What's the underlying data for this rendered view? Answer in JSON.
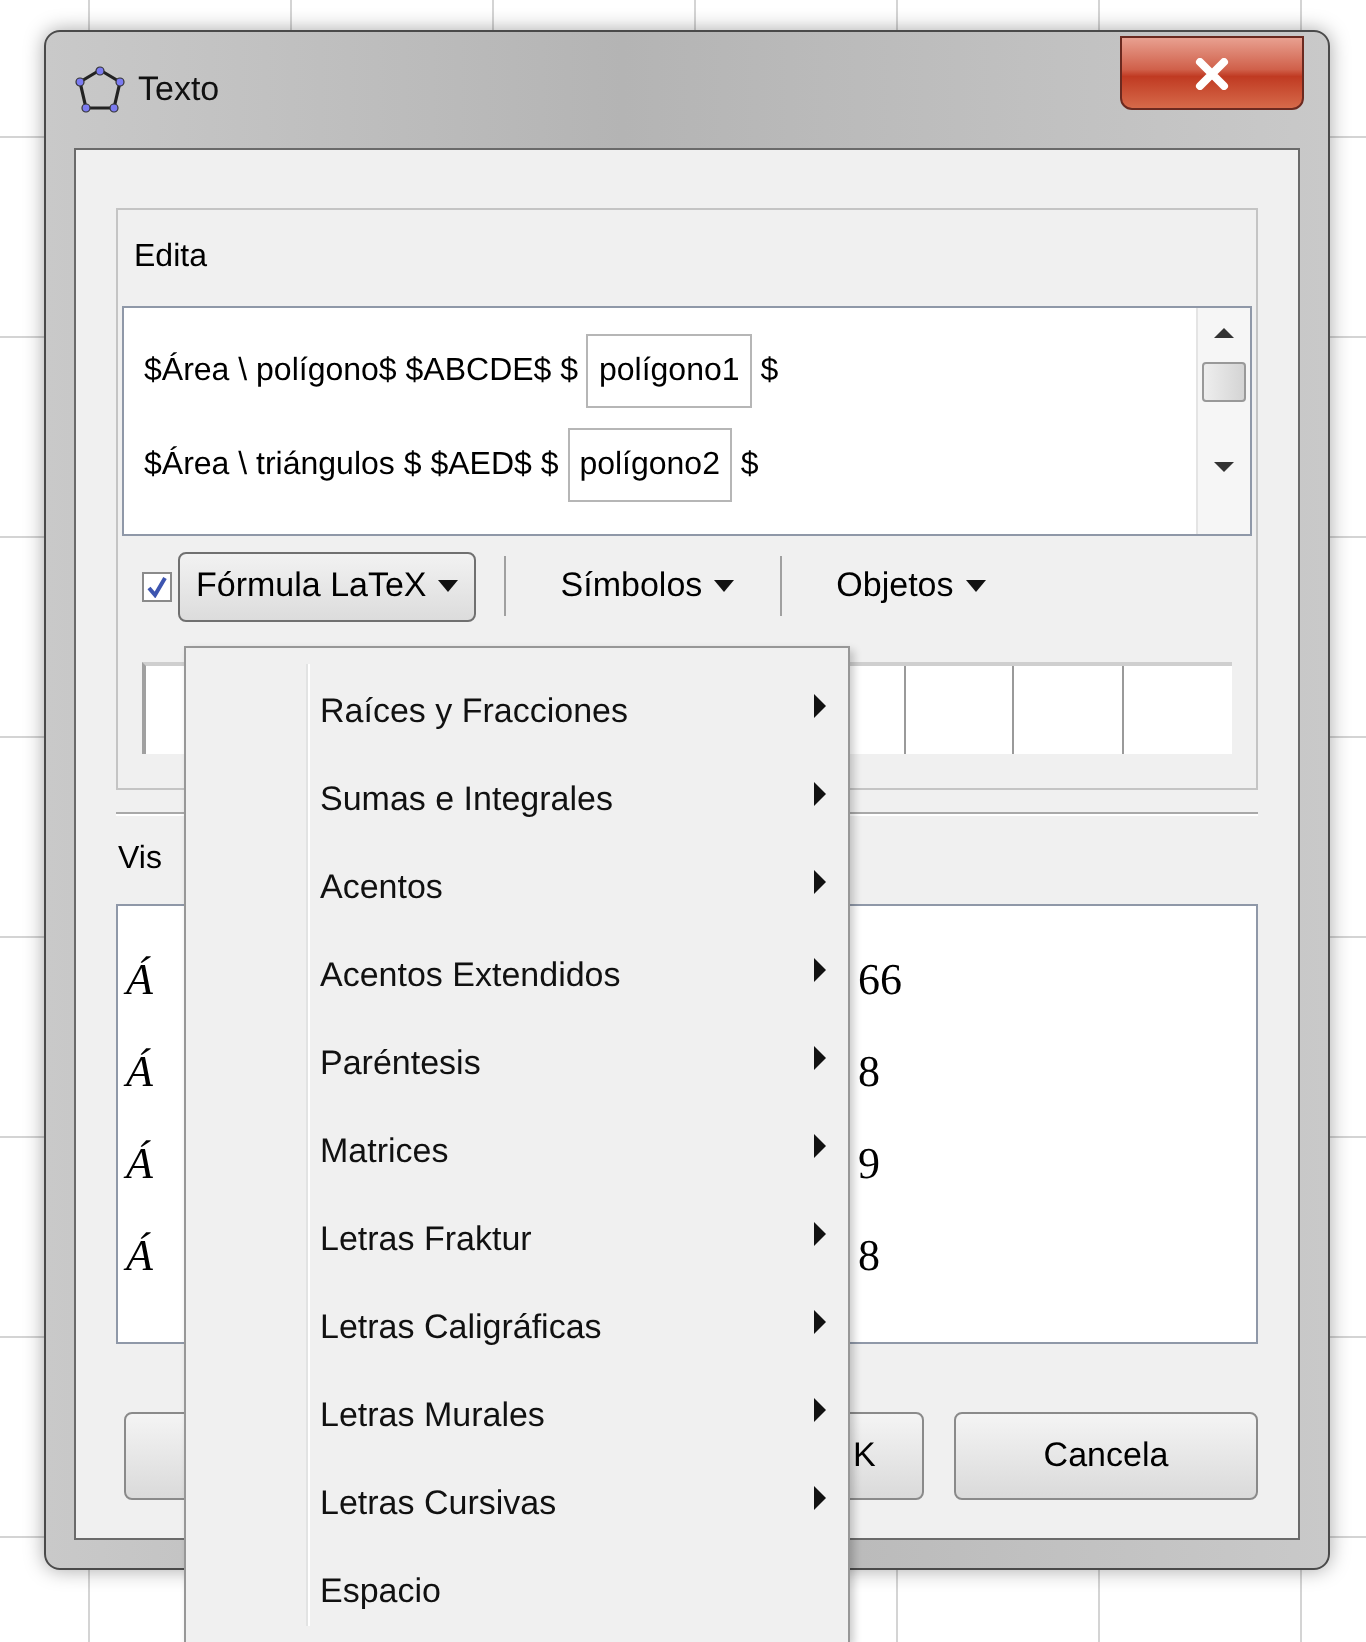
{
  "window": {
    "title": "Texto"
  },
  "edit_panel": {
    "label": "Edita",
    "lines": [
      {
        "text": "$Área \\ polígono$ $ABCDE$ $",
        "object": "polígono1",
        "after": "$"
      },
      {
        "text": "$Área \\ triángulos $ $AED$ $",
        "object": "polígono2",
        "after": "$"
      }
    ]
  },
  "toolbar": {
    "latex": {
      "label": "Fórmula LaTeX",
      "checked": true,
      "expanded": true
    },
    "menus": [
      {
        "label": "Símbolos",
        "expanded": false
      },
      {
        "label": "Objetos",
        "expanded": false
      }
    ]
  },
  "preview": {
    "label": "Vis",
    "rows": [
      {
        "symbol": "Á",
        "value": "66"
      },
      {
        "symbol": "Á",
        "value": "8"
      },
      {
        "symbol": "Á",
        "value": "9"
      },
      {
        "symbol": "Á",
        "value": "8"
      }
    ]
  },
  "buttons": [
    {
      "kind": "covered"
    },
    {
      "kind": "partial",
      "label": "K"
    },
    {
      "kind": "full",
      "label": "Cancela"
    }
  ],
  "menu": {
    "items": [
      {
        "label": "Raíces y Fracciones",
        "submenu": true
      },
      {
        "label": "Sumas e Integrales",
        "submenu": true
      },
      {
        "label": "Acentos",
        "submenu": true
      },
      {
        "label": "Acentos Extendidos",
        "submenu": true
      },
      {
        "label": "Paréntesis",
        "submenu": true
      },
      {
        "label": "Matrices",
        "submenu": true
      },
      {
        "label": "Letras Fraktur",
        "submenu": true
      },
      {
        "label": "Letras Caligráficas",
        "submenu": true
      },
      {
        "label": "Letras Murales",
        "submenu": true
      },
      {
        "label": "Letras Cursivas",
        "submenu": true
      },
      {
        "label": "Espacio",
        "submenu": false
      }
    ]
  }
}
